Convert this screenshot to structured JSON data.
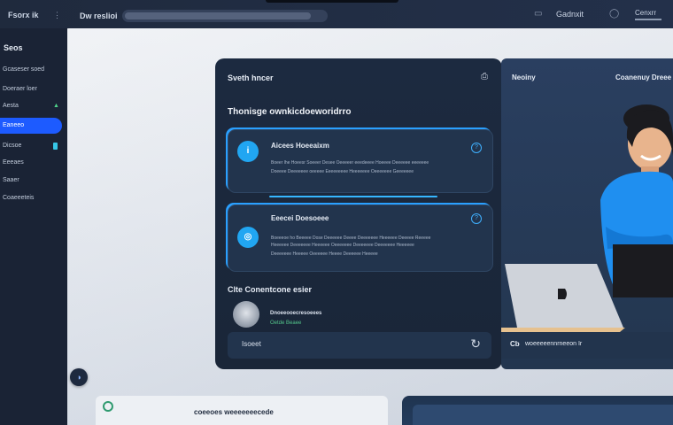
{
  "topbar": {
    "brand": "Fsorx ik",
    "menu_icon": "more-icon",
    "title": "Dw reslioi",
    "account": "Gadnxit",
    "shield_icon": "shield-icon",
    "calendar_icon": "calendar-icon",
    "user": "Cenxrr"
  },
  "sidebar": {
    "title": "Seos",
    "items": [
      {
        "label": "Gcaseser soed"
      },
      {
        "label": "Doeraer loer"
      },
      {
        "label": "Aesta"
      },
      {
        "label": "Eaneeo"
      },
      {
        "label": "Dicsoe"
      },
      {
        "label": "Eeeaes"
      },
      {
        "label": "Saaer"
      },
      {
        "label": "Coaeeeteis"
      }
    ],
    "colors": {
      "active": "#1d5bff",
      "marker_up": "#4fd38a",
      "marker_cyan": "#36c7e8"
    }
  },
  "main_card": {
    "title": "Sveth hncer",
    "subtitle": "Thonisge ownkicdoeworidrro",
    "panels": [
      {
        "title": "Aicees Hoeeaixm",
        "lines": [
          "Boeer lhe Hoeesr Soeeer Desee Oeeeeer eeedeeee Hoeeee Deeeeee eeeeeee",
          "Doeeee Deeeeeee oeeeee Eeeeeeeee Heeeeeee Oeeeeeee Geeeeeee"
        ]
      },
      {
        "title": "Eeecei Doesoeee",
        "lines": [
          "Boeeeoe ho Beeeee Dose Deeeeee Deeee Deeeeeee Heeeeee Deeeee Reeeee",
          "Heeeeee Deeeeeee Heeeeee Oeeeeeee Deeeeeee Deeeeeee Heeeeee",
          "Deeeeeee Heeeee Oeeeeee Heeee Deeeeee Heeeee"
        ]
      }
    ],
    "section_title": "Clte Conentcone esier",
    "item": {
      "title": "Dnoeeooecresoeees",
      "subtitle": "Oetde Beaee"
    },
    "footer_label": "Isoeet"
  },
  "right_card": {
    "left_label": "Neoiny",
    "right_label": "Coanenuy Dreee",
    "footer_icon": "Cb",
    "footer_label": "woeeeeennrneeon Ir"
  },
  "bottom": {
    "label": "coeeoes weeeeeeecede"
  },
  "colors": {
    "accent": "#2aa0ff",
    "icon_blue": "#21a6f2",
    "card_bg": "#1c2a40",
    "panel_bg": "#22344d"
  }
}
